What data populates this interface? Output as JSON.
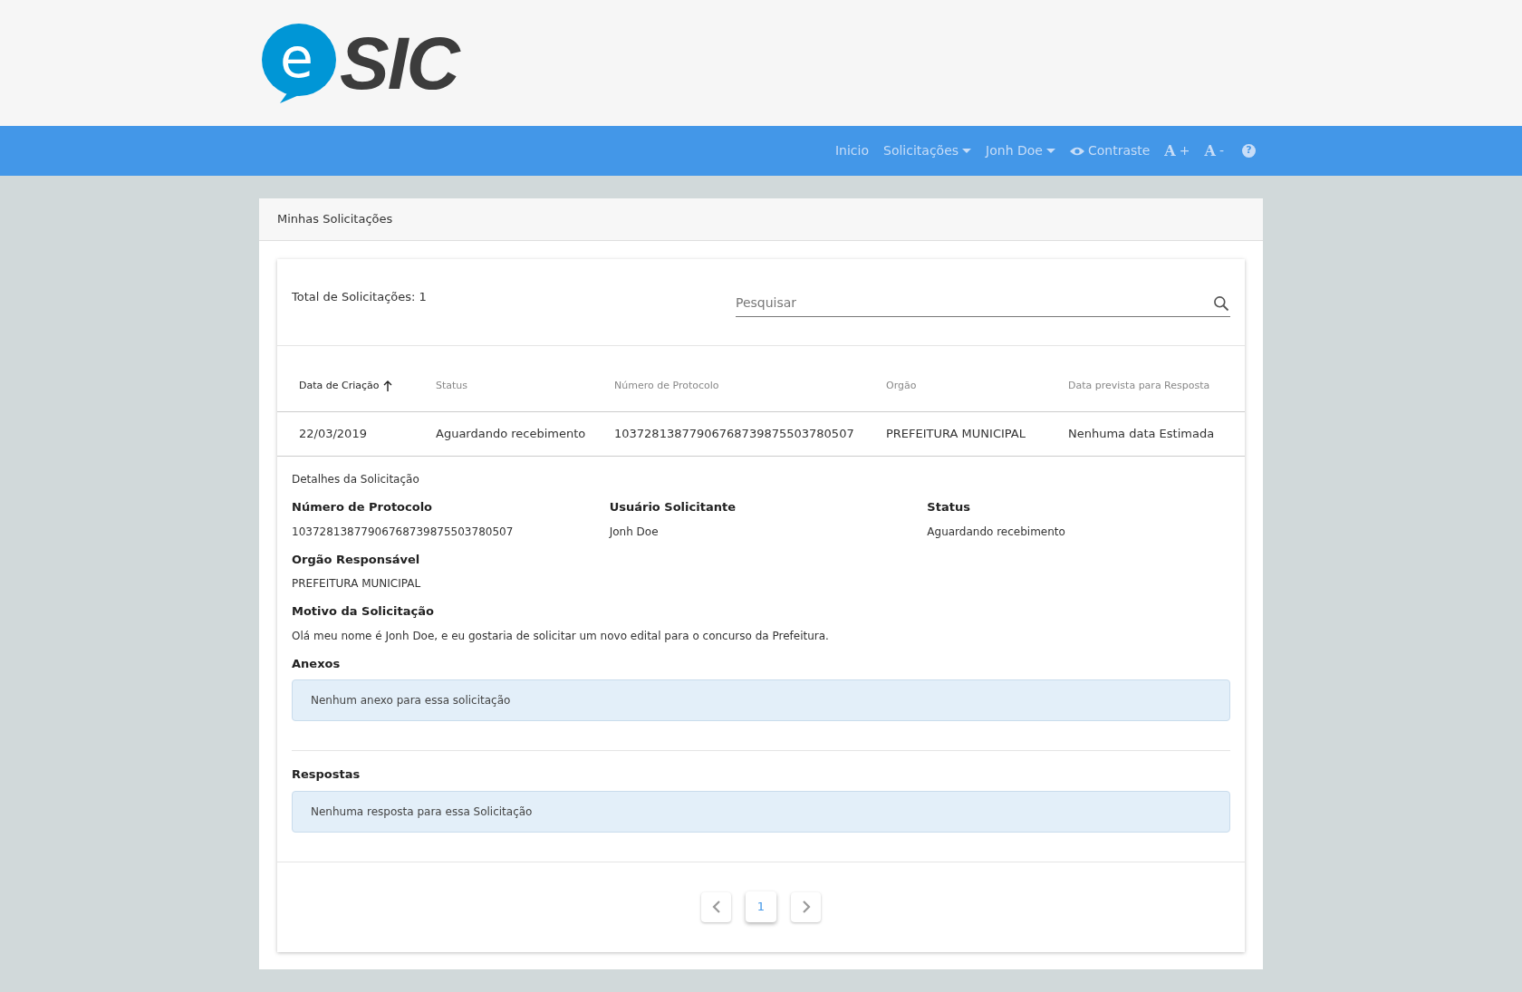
{
  "logo": {
    "mark": "e",
    "word": "SIC"
  },
  "nav": [
    {
      "label": "Inicio",
      "kind": "link"
    },
    {
      "label": "Solicitações",
      "kind": "dropdown"
    },
    {
      "label": "Jonh Doe",
      "kind": "dropdown"
    },
    {
      "label": "Contraste",
      "kind": "contrast"
    },
    {
      "label": "A",
      "suffix": "+",
      "kind": "font"
    },
    {
      "label": "A",
      "suffix": "-",
      "kind": "font"
    },
    {
      "label": "?",
      "kind": "help"
    }
  ],
  "panel": {
    "title": "Minhas Solicitações"
  },
  "total": "Total de Solicitações: 1",
  "search": {
    "placeholder": "Pesquisar"
  },
  "table": {
    "columns": [
      {
        "label": "Data de Criação",
        "sorted": true
      },
      {
        "label": "Status",
        "sorted": false
      },
      {
        "label": "Número de Protocolo",
        "sorted": false
      },
      {
        "label": "Orgão",
        "sorted": false
      },
      {
        "label": "Data prevista para Resposta",
        "sorted": false
      }
    ],
    "rows": [
      [
        "22/03/2019",
        "Aguardando recebimento",
        "10372813877906768739875503780507",
        "PREFEITURA MUNICIPAL",
        "Nenhuma data Estimada"
      ]
    ]
  },
  "details": {
    "title": "Detalhes da Solicitação",
    "fields": [
      {
        "label": "Número de Protocolo",
        "value": "10372813877906768739875503780507"
      },
      {
        "label": "Usuário Solicitante",
        "value": "Jonh Doe"
      },
      {
        "label": "Status",
        "value": "Aguardando recebimento"
      },
      {
        "label": "Orgão Responsável",
        "value": "PREFEITURA MUNICIPAL"
      },
      {
        "label": "Motivo da Solicitação",
        "value": "Olá meu nome é Jonh Doe, e eu gostaria de solicitar um novo edital para o concurso da Prefeitura."
      }
    ],
    "sections": [
      {
        "label": "Anexos",
        "message": "Nenhum anexo para essa solicitação"
      },
      {
        "label": "Respostas",
        "message": "Nenhuma resposta para essa Solicitação"
      }
    ]
  },
  "pagination": [
    {
      "label": "1",
      "selected": true
    }
  ]
}
